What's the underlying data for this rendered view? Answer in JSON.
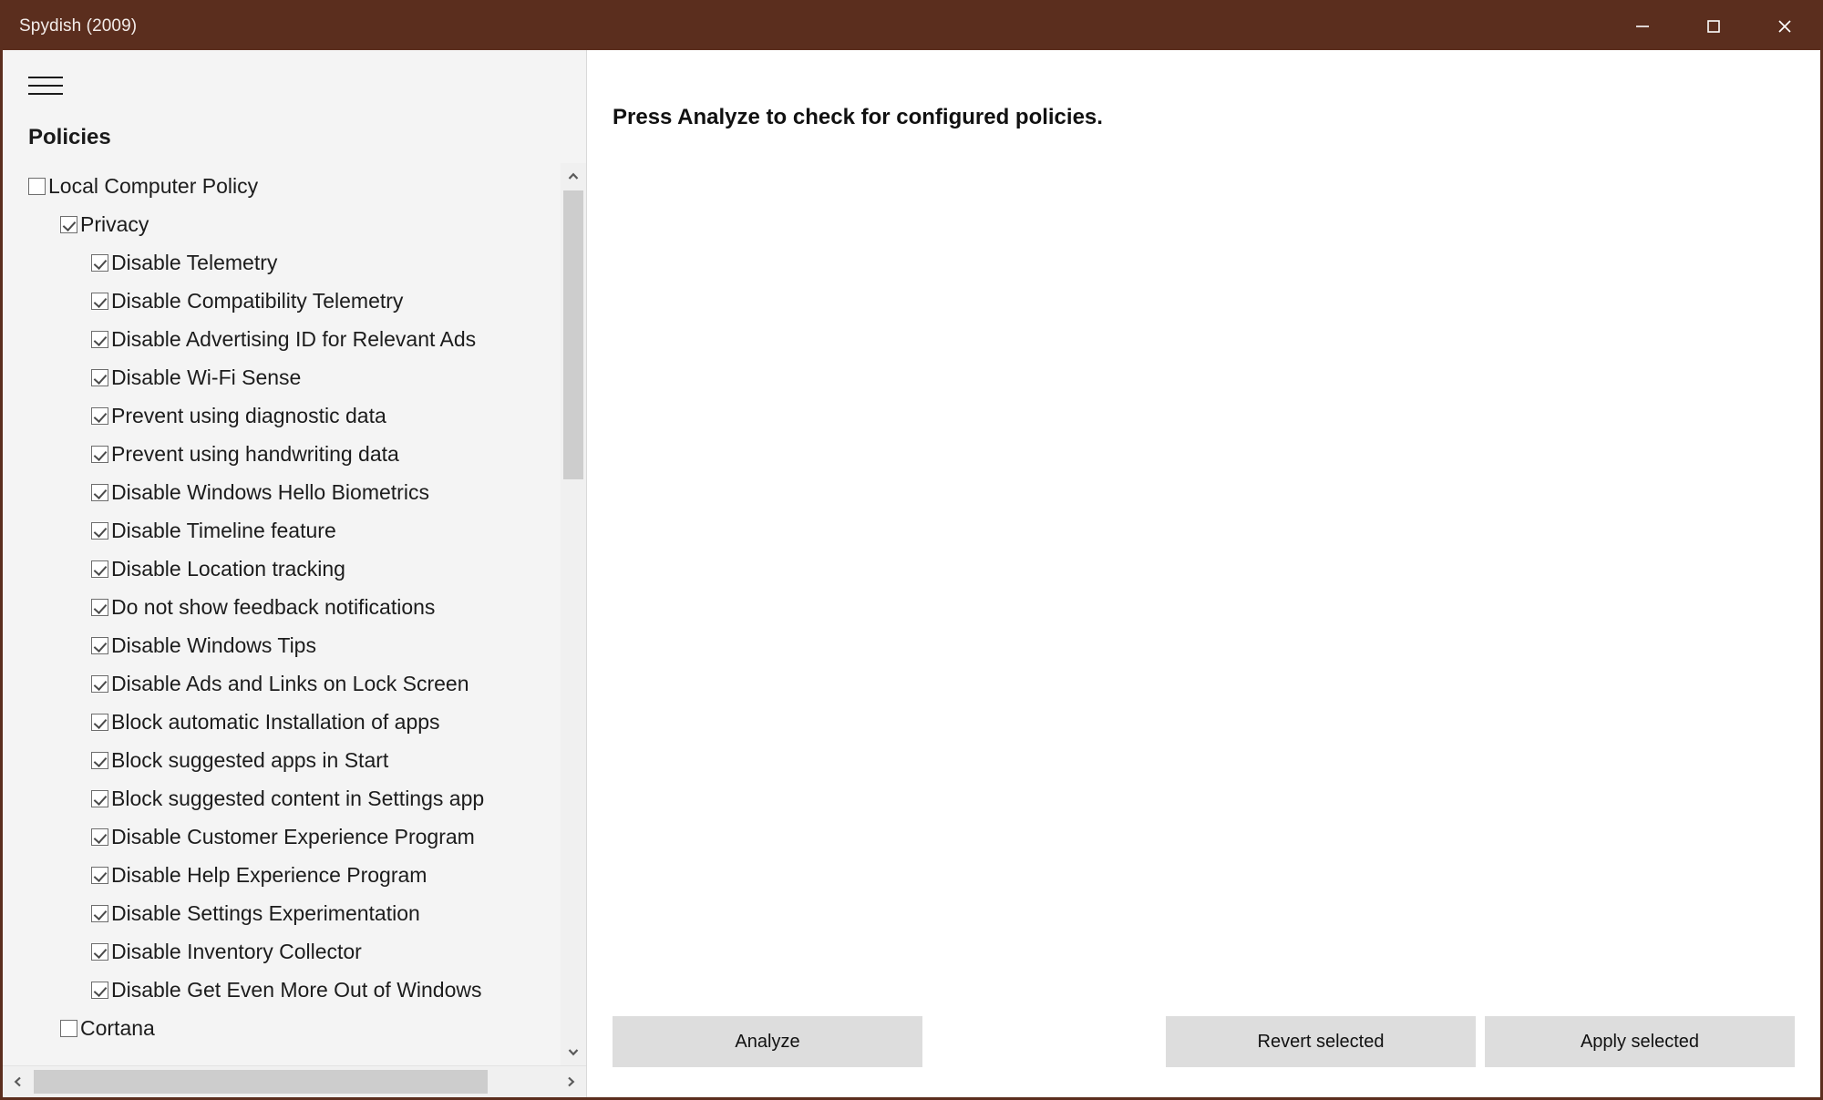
{
  "window": {
    "title": "Spydish (2009)",
    "titlebar_color": "#5b2e1e",
    "controls": {
      "minimize": "minimize",
      "maximize": "maximize",
      "close": "close"
    }
  },
  "sidebar": {
    "menu_icon": "hamburger-icon",
    "heading": "Policies",
    "tree": [
      {
        "label": "Local Computer Policy",
        "level": 0,
        "checked": false
      },
      {
        "label": "Privacy",
        "level": 1,
        "checked": true
      },
      {
        "label": "Disable Telemetry",
        "level": 2,
        "checked": true
      },
      {
        "label": "Disable Compatibility Telemetry",
        "level": 2,
        "checked": true
      },
      {
        "label": "Disable Advertising ID for Relevant Ads",
        "level": 2,
        "checked": true
      },
      {
        "label": "Disable Wi-Fi Sense",
        "level": 2,
        "checked": true
      },
      {
        "label": "Prevent using diagnostic data",
        "level": 2,
        "checked": true
      },
      {
        "label": "Prevent using handwriting data",
        "level": 2,
        "checked": true
      },
      {
        "label": "Disable Windows Hello Biometrics",
        "level": 2,
        "checked": true
      },
      {
        "label": "Disable Timeline feature",
        "level": 2,
        "checked": true
      },
      {
        "label": "Disable Location tracking",
        "level": 2,
        "checked": true
      },
      {
        "label": "Do not show feedback notifications",
        "level": 2,
        "checked": true
      },
      {
        "label": "Disable Windows Tips",
        "level": 2,
        "checked": true
      },
      {
        "label": "Disable Ads and Links on Lock Screen",
        "level": 2,
        "checked": true
      },
      {
        "label": "Block automatic Installation of apps",
        "level": 2,
        "checked": true
      },
      {
        "label": "Block suggested apps in Start",
        "level": 2,
        "checked": true
      },
      {
        "label": "Block suggested content in Settings app",
        "level": 2,
        "checked": true
      },
      {
        "label": "Disable Customer Experience Program",
        "level": 2,
        "checked": true
      },
      {
        "label": "Disable Help Experience Program",
        "level": 2,
        "checked": true
      },
      {
        "label": "Disable Settings Experimentation",
        "level": 2,
        "checked": true
      },
      {
        "label": "Disable Inventory Collector",
        "level": 2,
        "checked": true
      },
      {
        "label": "Disable Get Even More Out of Windows",
        "level": 2,
        "checked": true
      },
      {
        "label": "Cortana",
        "level": 1,
        "checked": false
      }
    ],
    "vertical_scrollbar": {
      "up_arrow": "chevron-up-icon",
      "down_arrow": "chevron-down-icon"
    },
    "horizontal_scrollbar": {
      "left_arrow": "chevron-left-icon",
      "right_arrow": "chevron-right-icon"
    }
  },
  "main": {
    "message": "Press Analyze to check for configured policies.",
    "buttons": {
      "analyze": "Analyze",
      "revert": "Revert selected",
      "apply": "Apply selected"
    }
  }
}
